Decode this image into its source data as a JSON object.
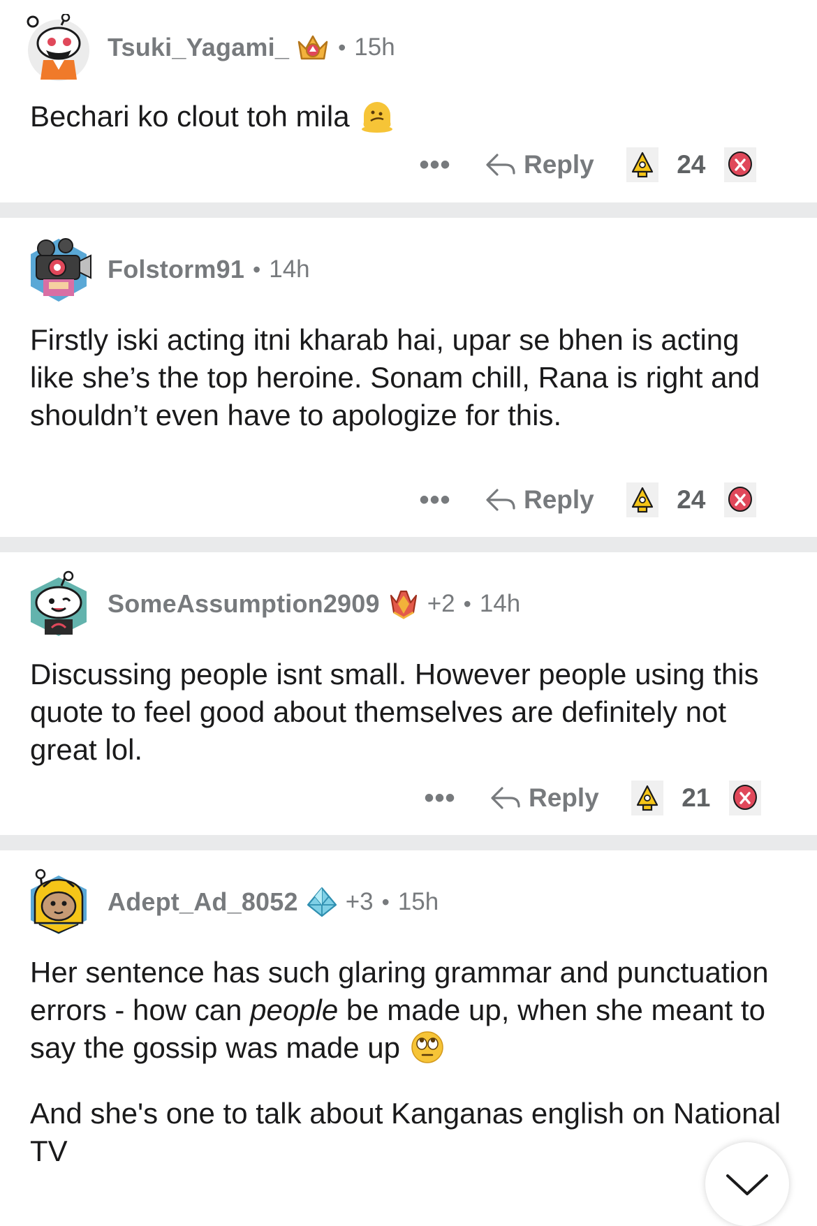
{
  "comments": [
    {
      "username": "Tsuki_Yagami_",
      "flair_icon": "crown-award-icon",
      "extra": "",
      "time": "15h",
      "text": [
        "Bechari ko clout toh mila"
      ],
      "emoji": "melting-face-icon",
      "more_label": "•••",
      "reply_label": "Reply",
      "score": "24"
    },
    {
      "username": "Folstorm91",
      "time": "14h",
      "text": [
        "Firstly iski acting itni kharab hai, upar se bhen is acting like she’s the top heroine. Sonam chill, Rana is right and shouldn’t even have to apologize for this."
      ],
      "more_label": "•••",
      "reply_label": "Reply",
      "score": "24"
    },
    {
      "username": "SomeAssumption2909",
      "flair_icon": "crystal-award-icon",
      "extra": "+2",
      "time": "14h",
      "text": [
        "Discussing people isnt small. However people using this quote to feel good about themselves are definitely not great lol."
      ],
      "more_label": "•••",
      "reply_label": "Reply",
      "score": "21"
    },
    {
      "username": "Adept_Ad_8052",
      "flair_icon": "diamond-award-icon",
      "extra": "+3",
      "time": "15h",
      "text_parts": {
        "p1_a": "Her sentence has such glaring grammar and punctuation errors - how can ",
        "p1_em": "people",
        "p1_b": " be made up, when she meant to say the gossip was made up",
        "p2": "And she's one to talk about Kanganas english on National TV"
      },
      "emoji": "eye-roll-face-icon"
    }
  ],
  "scroll_button_icon": "chevron-down-icon",
  "colors": {
    "meta_grey": "#777a7d",
    "separator": "#e9eaeb",
    "text": "#1a1a1b",
    "upvote_gold": "#f5c518",
    "downvote_red": "#e0485a"
  }
}
